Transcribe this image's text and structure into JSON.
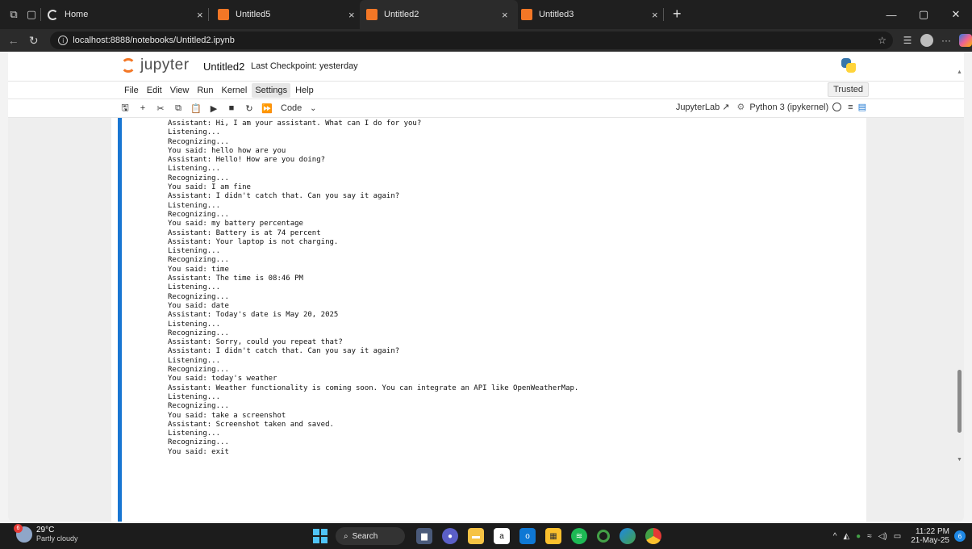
{
  "browser": {
    "tabs": [
      {
        "title": "Home",
        "active": false
      },
      {
        "title": "Untitled5",
        "active": false
      },
      {
        "title": "Untitled2",
        "active": true
      },
      {
        "title": "Untitled3",
        "active": false
      }
    ],
    "close_glyph": "×",
    "new_tab_glyph": "+",
    "address": "localhost:8888/notebooks/Untitled2.ipynb",
    "info_glyph": "i"
  },
  "jupyter": {
    "logo_word": "jupyter",
    "notebook_title": "Untitled2",
    "checkpoint": "Last Checkpoint: yesterday",
    "menu": [
      "File",
      "Edit",
      "View",
      "Run",
      "Kernel",
      "Settings",
      "Help"
    ],
    "active_menu": "Settings",
    "trusted": "Trusted",
    "cell_type": "Code",
    "jupyterlab_label": "JupyterLab",
    "kernel_label": "Python 3 (ipykernel)"
  },
  "output_lines": [
    "Assistant: Hi, I am your assistant. What can I do for you?",
    "Listening...",
    "Recognizing...",
    "You said: hello how are you",
    "Assistant: Hello! How are you doing?",
    "Listening...",
    "Recognizing...",
    "You said: I am fine",
    "Assistant: I didn't catch that. Can you say it again?",
    "Listening...",
    "Recognizing...",
    "You said: my battery percentage",
    "Assistant: Battery is at 74 percent",
    "Assistant: Your laptop is not charging.",
    "Listening...",
    "Recognizing...",
    "You said: time",
    "Assistant: The time is 08:46 PM",
    "Listening...",
    "Recognizing...",
    "You said: date",
    "Assistant: Today's date is May 20, 2025",
    "Listening...",
    "Recognizing...",
    "Assistant: Sorry, could you repeat that?",
    "Assistant: I didn't catch that. Can you say it again?",
    "Listening...",
    "Recognizing...",
    "You said: today's weather",
    "Assistant: Weather functionality is coming soon. You can integrate an API like OpenWeatherMap.",
    "Listening...",
    "Recognizing...",
    "You said: take a screenshot",
    "Assistant: Screenshot taken and saved.",
    "Listening...",
    "Recognizing...",
    "You said: exit"
  ],
  "taskbar": {
    "weather_temp": "29°C",
    "weather_desc": "Partly cloudy",
    "weather_badge": "6",
    "search_label": "Search",
    "time": "11:22 PM",
    "date": "21-May-25",
    "notification_count": "6"
  },
  "colors": {
    "jupyter_orange": "#f37726",
    "cell_selected_blue": "#1976d2",
    "taskbar_bg": "#1c1c1c"
  }
}
